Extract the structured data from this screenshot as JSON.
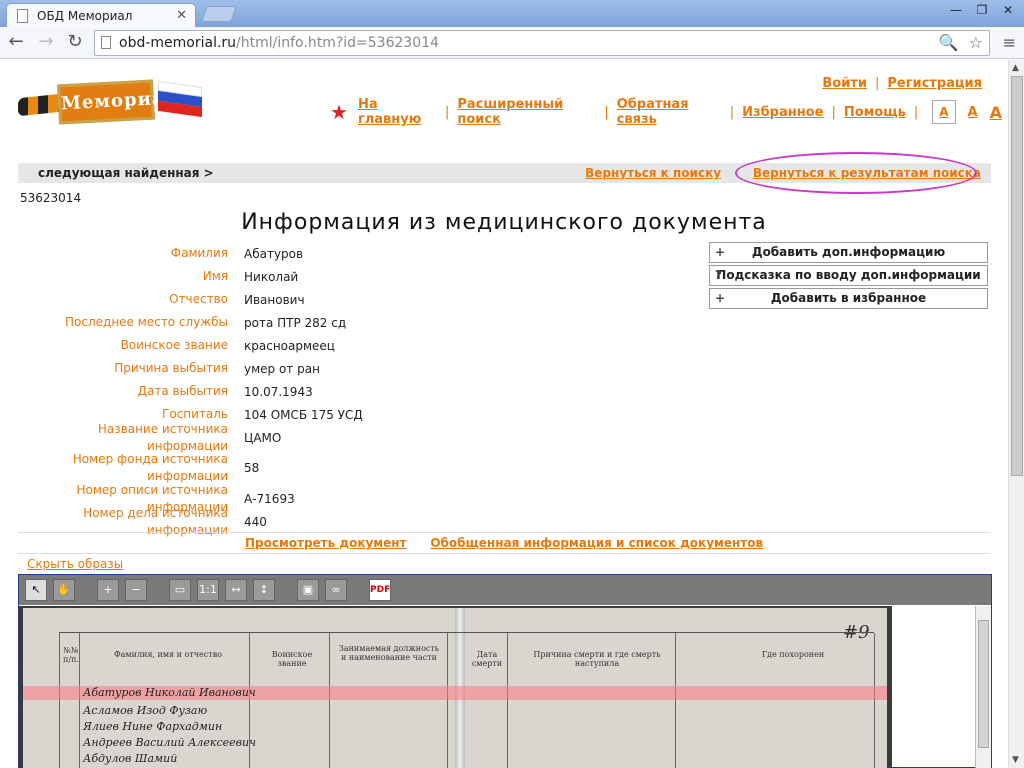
{
  "browser": {
    "tab_title": "ОБД Мемориал",
    "tab_close": "✕",
    "url_host": "obd-memorial.ru",
    "url_path": "/html/info.htm?id=53623014",
    "win_min": "—",
    "win_max": "❐",
    "win_close": "✕",
    "back": "←",
    "forward": "→",
    "reload": "↻",
    "zoom_icon": "🔍",
    "star_icon": "☆",
    "menu_icon": "≡"
  },
  "logo_text": "Мемориал",
  "top_links": {
    "login": "Войти",
    "register": "Регистрация"
  },
  "main_nav": [
    "На главную",
    "Расширенный поиск",
    "Обратная связь",
    "Избранное",
    "Помощь"
  ],
  "font_sizes": [
    "A",
    "A",
    "A"
  ],
  "navbar": {
    "next": "следующая найденная >",
    "back_to_search": "Вернуться к поиску",
    "back_to_results": "Вернуться к результатам поиска"
  },
  "record_id": "53623014",
  "title": "Информация из медицинского документа",
  "fields": [
    {
      "label": "Фамилия",
      "value": "Абатуров"
    },
    {
      "label": "Имя",
      "value": "Николай"
    },
    {
      "label": "Отчество",
      "value": "Иванович"
    },
    {
      "label": "Последнее место службы",
      "value": "рота ПТР 282 сд"
    },
    {
      "label": "Воинское звание",
      "value": "красноармеец"
    },
    {
      "label": "Причина выбытия",
      "value": "умер от ран"
    },
    {
      "label": "Дата выбытия",
      "value": "10.07.1943"
    },
    {
      "label": "Госпиталь",
      "value": "104 ОМСБ 175 УСД"
    },
    {
      "label": "Название источника информации",
      "value": "ЦАМО"
    },
    {
      "label": "Номер фонда источника информации",
      "value": "58"
    },
    {
      "label": "Номер описи источника информации",
      "value": "А-71693"
    },
    {
      "label": "Номер дела источника информации",
      "value": "440"
    }
  ],
  "side_buttons": [
    {
      "prefix": "+",
      "label": "Добавить доп.информацию"
    },
    {
      "prefix": "?",
      "label": "Подсказка по вводу доп.информации"
    },
    {
      "prefix": "+",
      "label": "Добавить в избранное"
    }
  ],
  "view_links": {
    "view_doc": "Просмотреть документ",
    "summary": "Обобщенная информация и список документов"
  },
  "hide_images": "Скрыть образы",
  "viewer_tools": [
    {
      "icon": "pointer-icon",
      "glyph": "↖"
    },
    {
      "icon": "hand-icon",
      "glyph": "✋"
    },
    {
      "icon": "zoom-in-icon",
      "glyph": "+"
    },
    {
      "icon": "zoom-out-icon",
      "glyph": "−"
    },
    {
      "icon": "fit-page-icon",
      "glyph": "▭"
    },
    {
      "icon": "actual-size-icon",
      "glyph": "1:1"
    },
    {
      "icon": "fit-width-icon",
      "glyph": "↔"
    },
    {
      "icon": "fit-height-icon",
      "glyph": "↕"
    },
    {
      "icon": "save-icon",
      "glyph": "▣"
    },
    {
      "icon": "link-icon",
      "glyph": "∞"
    },
    {
      "icon": "pdf-icon",
      "glyph": "PDF"
    }
  ],
  "scan": {
    "headers": [
      "№№ п/п.",
      "Фамилия, имя и отчество",
      "Воинское звание",
      "Занимаемая должность и наименование части",
      "Дата смерти",
      "Причина смерти и где смерть наступила",
      "Где похоронен"
    ],
    "page_num": "#9",
    "rows": [
      "Абатуров Николай Иванович",
      "Асламов Изод Фузаю",
      "Ялиев Нине Фархадмин",
      "Андреев Василий Алексеевич",
      "Абдулов Шамий"
    ]
  },
  "colors": {
    "accent": "#e8780c",
    "highlight": "#ff7882",
    "circle": "#c83ac8"
  }
}
